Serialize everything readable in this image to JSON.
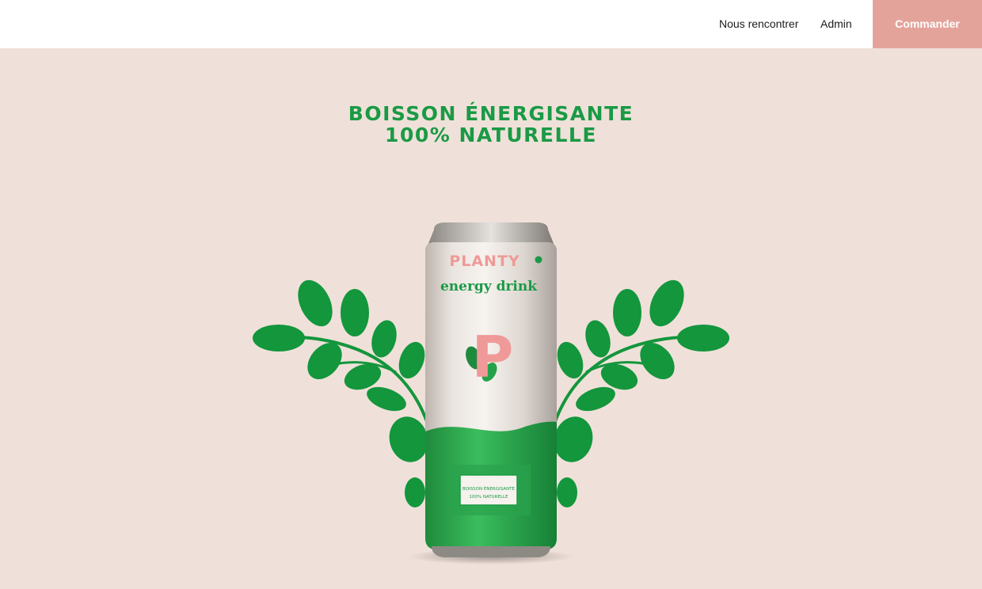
{
  "nav": {
    "links": [
      "Nous rencontrer",
      "Admin"
    ],
    "cta_label": "Commander"
  },
  "hero": {
    "headline_line1": "BOISSON ÉNERGISANTE",
    "headline_line2": "100% NATURELLE"
  },
  "product": {
    "brand": "PLANTY",
    "subtitle": "energy drink",
    "monogram": "P",
    "label_line1": "BOISSON ÉNERGISANTE",
    "label_line2": "100% NATURELLE"
  },
  "colors": {
    "background": "#efe1d9",
    "accent": "#e4a39a",
    "green": "#1a9a45"
  }
}
